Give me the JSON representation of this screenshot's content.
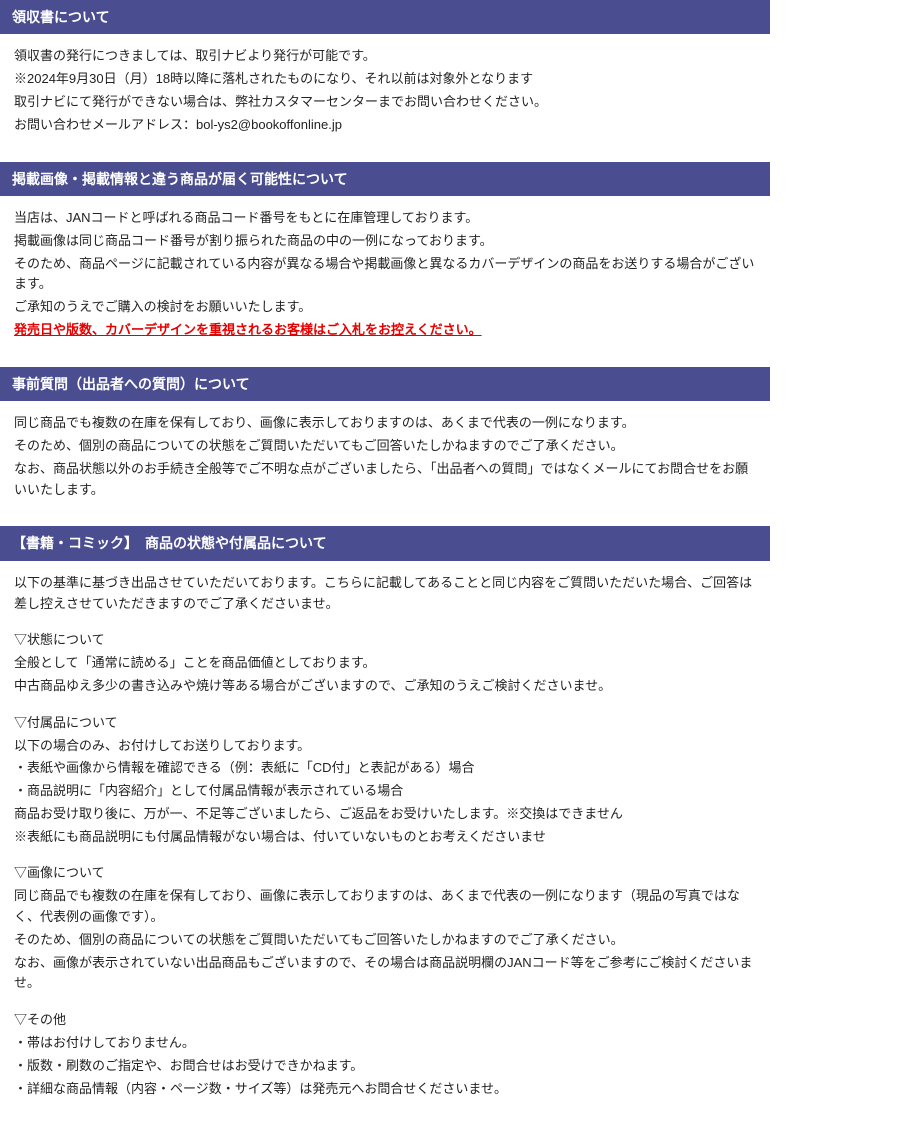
{
  "sections": {
    "receipt": {
      "title": "領収書について",
      "l1": "領収書の発行につきましては、取引ナビより発行が可能です。",
      "l2": "※2024年9月30日（月）18時以降に落札されたものになり、それ以前は対象外となります",
      "l3": "取引ナビにて発行ができない場合は、弊社カスタマーセンターまでお問い合わせください。",
      "l4": "お問い合わせメールアドレス：bol-ys2@bookoffonline.jp"
    },
    "image_diff": {
      "title": "掲載画像・掲載情報と違う商品が届く可能性について",
      "l1": "当店は、JANコードと呼ばれる商品コード番号をもとに在庫管理しております。",
      "l2": "掲載画像は同じ商品コード番号が割り振られた商品の中の一例になっております。",
      "l3": "そのため、商品ページに記載されている内容が異なる場合や掲載画像と異なるカバーデザインの商品をお送りする場合がございます。",
      "l4": "ご承知のうえでご購入の検討をお願いいたします。",
      "l5": "発売日や版数、カバーデザインを重視されるお客様はご入札をお控えください。"
    },
    "pre_question": {
      "title": "事前質問（出品者への質問）について",
      "l1": "同じ商品でも複数の在庫を保有しており、画像に表示しておりますのは、あくまで代表の一例になります。",
      "l2": "そのため、個別の商品についての状態をご質問いただいてもご回答いたしかねますのでご了承ください。",
      "l3": "なお、商品状態以外のお手続き全般等でご不明な点がございましたら、「出品者への質問」ではなくメールにてお問合せをお願いいたします。"
    },
    "books": {
      "title": "【書籍・コミック】　商品の状態や付属品について",
      "intro": "以下の基準に基づき出品させていただいております。こちらに記載してあることと同じ内容をご質問いただいた場合、ご回答は差し控えさせていただきますのでご了承くださいませ。",
      "h1": "▽状態について",
      "h1_l1": "全般として「通常に読める」ことを商品価値としております。",
      "h1_l2": "中古商品ゆえ多少の書き込みや焼け等ある場合がございますので、ご承知のうえご検討くださいませ。",
      "h2": "▽付属品について",
      "h2_l1": "以下の場合のみ、お付けしてお送りしております。",
      "h2_l2": "・表紙や画像から情報を確認できる（例：表紙に「CD付」と表記がある）場合",
      "h2_l3": "・商品説明に「内容紹介」として付属品情報が表示されている場合",
      "h2_l4": "商品お受け取り後に、万が一、不足等ございましたら、ご返品をお受けいたします。※交換はできません",
      "h2_l5": "※表紙にも商品説明にも付属品情報がない場合は、付いていないものとお考えくださいませ",
      "h3": "▽画像について",
      "h3_l1": "同じ商品でも複数の在庫を保有しており、画像に表示しておりますのは、あくまで代表の一例になります（現品の写真ではなく、代表例の画像です）。",
      "h3_l2": "そのため、個別の商品についての状態をご質問いただいてもご回答いたしかねますのでご了承ください。",
      "h3_l3": "なお、画像が表示されていない出品商品もございますので、その場合は商品説明欄のJANコード等をご参考にご検討くださいませ。",
      "h4": "▽その他",
      "h4_l1": "・帯はお付けしておりません。",
      "h4_l2": "・版数・刷数のご指定や、お問合せはお受けできかねます。",
      "h4_l3": "・詳細な商品情報（内容・ページ数・サイズ等）は発売元へお問合せくださいませ。"
    }
  }
}
